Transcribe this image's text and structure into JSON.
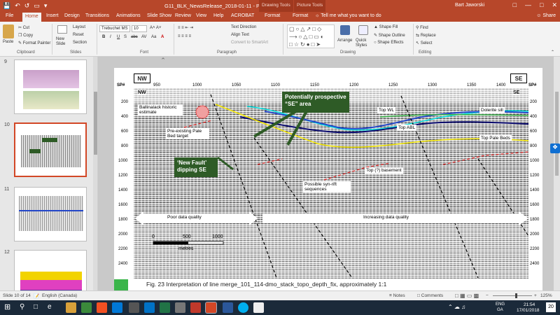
{
  "window": {
    "title": "G11_BLK_NewsRelease_2018-01-11  -  PowerPoint",
    "context_tabs": [
      "Drawing Tools",
      "Picture Tools"
    ],
    "user": "Bart Jaworski"
  },
  "tabs": [
    "File",
    "Home",
    "Insert",
    "Design",
    "Transitions",
    "Animations",
    "Slide Show",
    "Review",
    "View",
    "Help",
    "ACROBAT",
    "Format",
    "Format"
  ],
  "tell_me": "Tell me what you want to do",
  "share": "Share",
  "ribbon": {
    "clipboard": {
      "label": "Clipboard",
      "paste": "Paste",
      "cut": "Cut",
      "copy": "Copy",
      "format_painter": "Format Painter"
    },
    "slides": {
      "label": "Slides",
      "new_slide": "New Slide",
      "layout": "Layout",
      "reset": "Reset",
      "section": "Section"
    },
    "font": {
      "label": "Font",
      "family": "Trebuchet MS",
      "size": "10",
      "buttons": [
        "B",
        "I",
        "U",
        "S",
        "abc",
        "AV",
        "Aa",
        "A"
      ]
    },
    "paragraph": {
      "label": "Paragraph",
      "text_direction": "Text Direction",
      "align_text": "Align Text",
      "convert": "Convert to SmartArt"
    },
    "drawing": {
      "label": "Drawing",
      "arrange": "Arrange",
      "quick_styles": "Quick Styles",
      "shape_fill": "Shape Fill",
      "shape_outline": "Shape Outline",
      "shape_effects": "Shape Effects"
    },
    "editing": {
      "label": "Editing",
      "find": "Find",
      "replace": "Replace",
      "select": "Select"
    }
  },
  "thumbnails": [
    {
      "num": "9"
    },
    {
      "num": "10"
    },
    {
      "num": "11"
    },
    {
      "num": "12"
    }
  ],
  "slide": {
    "nw": "NW",
    "se": "SE",
    "sp": "SP#",
    "nw_inner": "NW",
    "se_inner": "SE",
    "top_ticks": [
      "950",
      "1000",
      "1050",
      "1100",
      "1150",
      "1200",
      "1250",
      "1300",
      "1350",
      "1400"
    ],
    "depth_ticks": [
      "200",
      "400",
      "600",
      "800",
      "1000",
      "1200",
      "1400",
      "1600",
      "1800",
      "2000",
      "2200",
      "2400"
    ],
    "labels": {
      "ballinalack": "Ballinalack historic estimate",
      "preexisting": "Pre-existing Pale Bed target",
      "top_wl": "Top WL",
      "dolerite": "Dolerite sill",
      "top_abl": "Top ABL",
      "top_pale": "Top Pale Beds",
      "basement": "Top (?) basement",
      "synrift": "Possible syn-rift sequences",
      "poor": "Poor data quality",
      "increasing": "Increasing data quality"
    },
    "callout_prospective": "Potentially prospective “SE” area",
    "callout_fault": "‘New Fault’ dipping SE",
    "scale": {
      "zero": "0",
      "five": "500",
      "thousand": "1000",
      "unit": "metres"
    },
    "caption": "Fig. 23 Interpretation of line merge_101_114-dmo_stack_topo_depth_fix, approximately 1:1"
  },
  "status": {
    "slide": "Slide 10 of 14",
    "language": "English (Canada)",
    "notes": "Notes",
    "comments": "Comments",
    "zoom": "125%"
  },
  "taskbar": {
    "lang": "ENG",
    "region": "GA",
    "time": "21:54",
    "date": "17/01/2018",
    "notify": "20"
  },
  "colors": {
    "accent": "#b7472a",
    "callout_green": "#2e5b26",
    "horizon_wl": "#2346c8",
    "horizon_abl": "#0a0a6e",
    "horizon_cyan": "#00e0e0",
    "horizon_green": "#3ab54a",
    "horizon_yellow": "#f5e800",
    "red_dash": "#e02020"
  }
}
